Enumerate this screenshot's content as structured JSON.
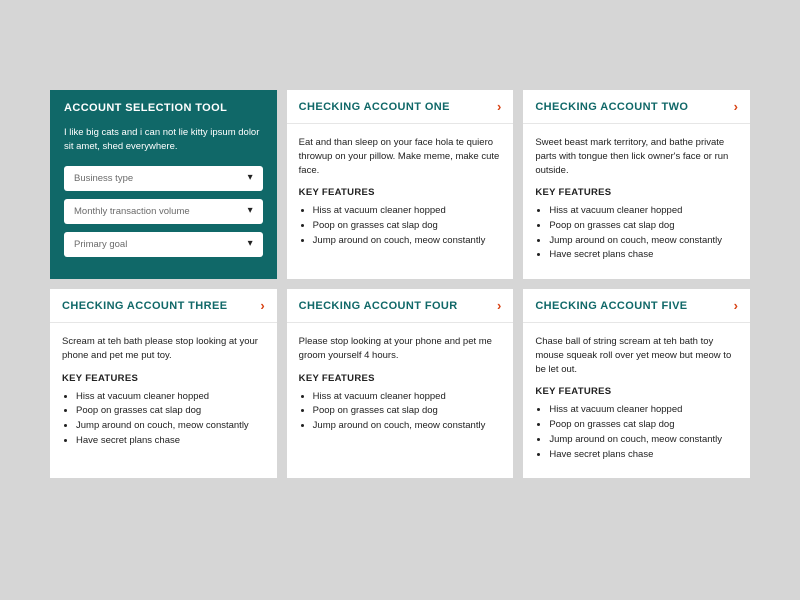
{
  "tool": {
    "title": "ACCOUNT SELECTION TOOL",
    "description": "I like big cats and i can not lie kitty ipsum dolor sit amet, shed everywhere.",
    "selects": [
      {
        "placeholder": "Business type"
      },
      {
        "placeholder": "Monthly transaction volume"
      },
      {
        "placeholder": "Primary goal"
      }
    ]
  },
  "features_heading": "KEY FEATURES",
  "cards": [
    {
      "title": "CHECKING ACCOUNT ONE",
      "description": "Eat and than sleep on your face hola te quiero throwup on your pillow. Make meme, make cute face.",
      "features": [
        "Hiss at vacuum cleaner hopped",
        "Poop on grasses cat slap dog",
        "Jump around on couch, meow constantly"
      ]
    },
    {
      "title": "CHECKING ACCOUNT TWO",
      "description": "Sweet beast mark territory, and bathe private parts with tongue then lick owner's face or run outside.",
      "features": [
        "Hiss at vacuum cleaner hopped",
        "Poop on grasses cat slap dog",
        "Jump around on couch, meow constantly",
        "Have secret plans chase"
      ]
    },
    {
      "title": "CHECKING ACCOUNT THREE",
      "description": "Scream at teh bath please stop looking at your phone and pet me put toy.",
      "features": [
        "Hiss at vacuum cleaner hopped",
        "Poop on grasses cat slap dog",
        "Jump around on couch, meow constantly",
        "Have secret plans chase"
      ]
    },
    {
      "title": "CHECKING ACCOUNT FOUR",
      "description": "Please stop looking at your phone and pet me groom yourself 4 hours.",
      "features": [
        "Hiss at vacuum cleaner hopped",
        "Poop on grasses cat slap dog",
        "Jump around on couch, meow constantly"
      ]
    },
    {
      "title": "CHECKING ACCOUNT FIVE",
      "description": "Chase ball of string scream at teh bath toy mouse squeak roll over yet meow but meow to be let out.",
      "features": [
        "Hiss at vacuum cleaner hopped",
        "Poop on grasses cat slap dog",
        "Jump around on couch, meow constantly",
        "Have secret plans chase"
      ]
    }
  ]
}
